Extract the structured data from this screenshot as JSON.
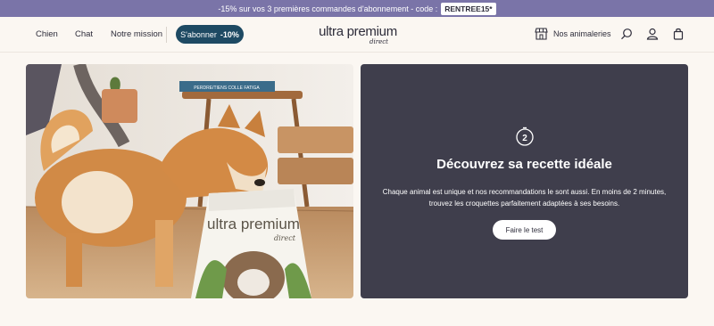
{
  "promo": {
    "text": "-15% sur vos 3 premières commandes d'abonnement - code :",
    "code": "RENTREE15*"
  },
  "nav": {
    "items": [
      "Chien",
      "Chat",
      "Notre mission"
    ]
  },
  "subscribe": {
    "label": "S'abonner",
    "discount": "-10%"
  },
  "logo": {
    "main": "ultra premium",
    "sub": "direct"
  },
  "header_right": {
    "stores_label": "Nos animaleries"
  },
  "hero_photo": {
    "bag_brand": "ultra premium",
    "bag_sub": "direct",
    "book_text": "PERDRE/TIENS COLLE FATIGA"
  },
  "recipe_card": {
    "badge": "2",
    "title": "Découvrez sa recette idéale",
    "description_line1": "Chaque animal est unique et nos recommandations le sont aussi. En moins de 2 minutes,",
    "description_line2": "trouvez les croquettes parfaitement adaptées à ses besoins.",
    "button": "Faire le test"
  },
  "colors": {
    "promo_bg": "#7a74a8",
    "subscribe_bg": "#1e4a63",
    "card_bg": "#3f3e4c",
    "page_bg": "#fbf7f2"
  }
}
